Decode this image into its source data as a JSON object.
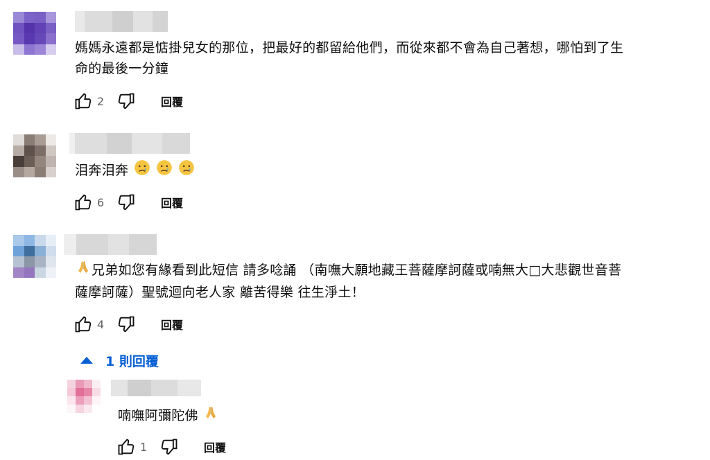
{
  "comments": [
    {
      "text": "媽媽永遠都是惦掛兒女的那位，把最好的都留給他們，而從來都不會為自己著想，哪怕到了生",
      "text2": "命的最後一分鐘",
      "likes": "2",
      "reply": "回覆"
    },
    {
      "text": "泪奔泪奔",
      "likes": "6",
      "reply": "回覆"
    },
    {
      "text": "兄弟如您有緣看到此短信  請多唸誦   （南嘸大願地藏王菩薩摩訶薩或喃無大□大悲觀世音菩",
      "text2": "薩摩訶薩）聖號迴向老人家 離苦得樂 往生淨土！",
      "likes": "4",
      "reply": "回覆"
    }
  ],
  "replies_toggle": "1 則回覆",
  "reply_comment": {
    "text": "喃嘸阿彌陀佛",
    "likes": "1",
    "reply": "回覆"
  },
  "icons": {
    "like": "thumbs-up-icon",
    "dislike": "thumbs-down-icon",
    "crying": "crying-face-emoji",
    "pray": "folded-hands-emoji",
    "collapse": "triangle-up-icon"
  },
  "colors": {
    "link": "#065fd4",
    "count": "#606060"
  }
}
